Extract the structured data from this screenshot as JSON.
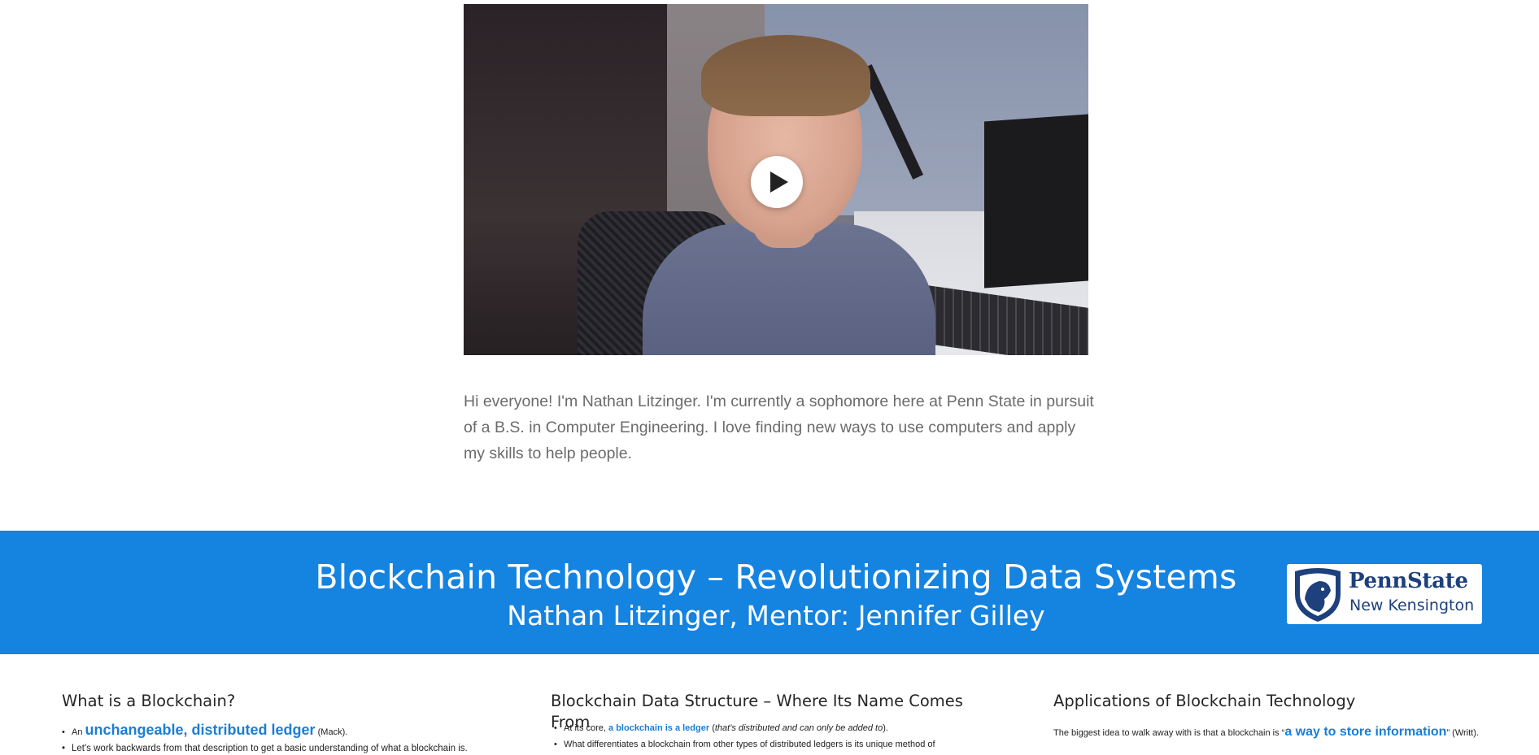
{
  "video": {
    "play_icon": "play-icon"
  },
  "bio": {
    "text": "Hi everyone! I'm Nathan Litzinger. I'm currently a sophomore here at Penn State in pursuit of a B.S. in Computer Engineering. I love finding new ways to use computers and apply my skills to help people."
  },
  "banner": {
    "title": "Blockchain Technology – Revolutionizing Data Systems",
    "subtitle": "Nathan Litzinger, Mentor: Jennifer Gilley",
    "logo": {
      "name": "PennState",
      "campus": "New Kensington"
    },
    "background": "#1583e0"
  },
  "columns": {
    "col1": {
      "heading": "What is a Blockchain?",
      "b1_pre": "An ",
      "b1_hl": "unchangeable, distributed ledger",
      "b1_post": " (Mack).",
      "b2": "Let's work backwards from that description to get a basic understanding of what a blockchain is."
    },
    "col2": {
      "heading": "Blockchain Data Structure – Where Its Name Comes From",
      "b1_pre": "At its core, ",
      "b1_hl": "a blockchain is a ledger",
      "b1_mid": " (",
      "b1_it": "that's distributed and can only be added to",
      "b1_post": ").",
      "b2": "What differentiates a blockchain from other types of distributed ledgers is its unique method of"
    },
    "col3": {
      "heading": "Applications of Blockchain Technology",
      "p1_pre": "The biggest idea to walk away with is that a blockchain is  “",
      "p1_hl": "a way to store information",
      "p1_post": "” (Writt)."
    }
  },
  "colors": {
    "accent": "#1a7ed6",
    "body_text": "#6b6b6b",
    "pennstate_navy": "#1e407c"
  }
}
